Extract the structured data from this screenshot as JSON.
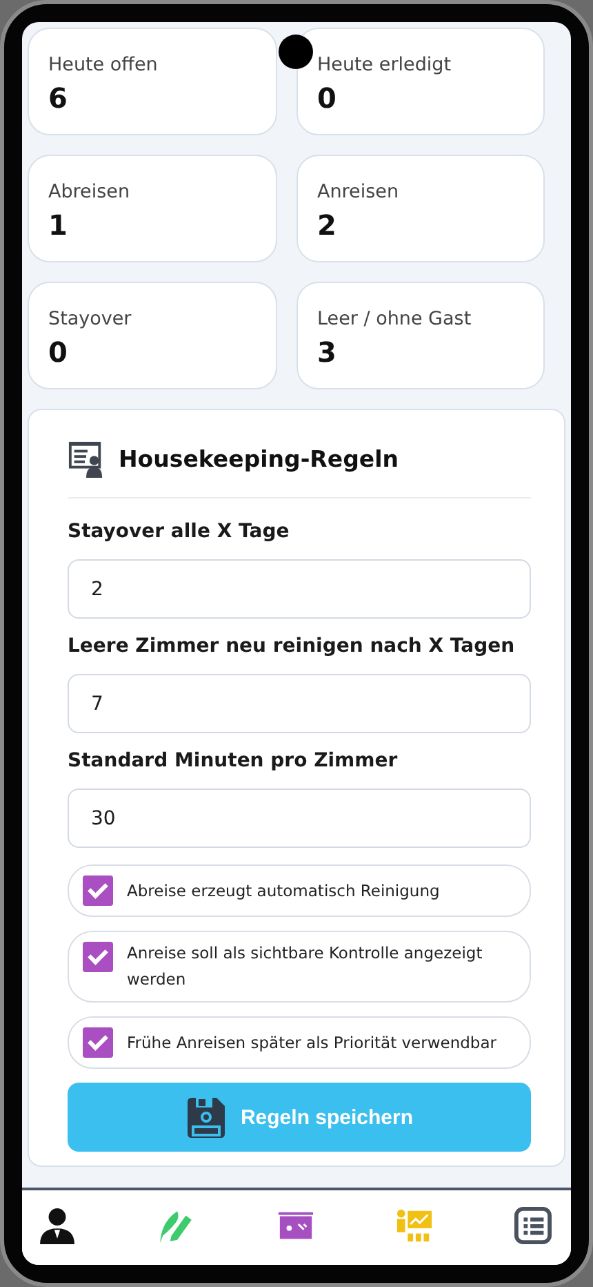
{
  "stats": [
    {
      "label": "Heute offen",
      "value": "6"
    },
    {
      "label": "Heute erledigt",
      "value": "0"
    },
    {
      "label": "Abreisen",
      "value": "1"
    },
    {
      "label": "Anreisen",
      "value": "2"
    },
    {
      "label": "Stayover",
      "value": "0"
    },
    {
      "label": "Leer / ohne Gast",
      "value": "3"
    }
  ],
  "rules": {
    "title": "Housekeeping-Regeln",
    "fields": [
      {
        "label": "Stayover alle X Tage",
        "value": "2"
      },
      {
        "label": "Leere Zimmer neu reinigen nach X Tagen",
        "value": "7"
      },
      {
        "label": "Standard Minuten pro Zimmer",
        "value": "30"
      }
    ],
    "options": [
      {
        "label": "Abreise erzeugt automatisch Reinigung",
        "checked": true
      },
      {
        "label": "Anreise soll als sichtbare Kontrolle angezeigt werden",
        "checked": true
      },
      {
        "label": "Frühe Anreisen später als Priorität verwendbar",
        "checked": true
      }
    ],
    "save_button": "Regeln speichern"
  },
  "nav": [
    {
      "kind": "person"
    },
    {
      "kind": "feather"
    },
    {
      "kind": "board"
    },
    {
      "kind": "presenter"
    },
    {
      "kind": "list"
    }
  ]
}
